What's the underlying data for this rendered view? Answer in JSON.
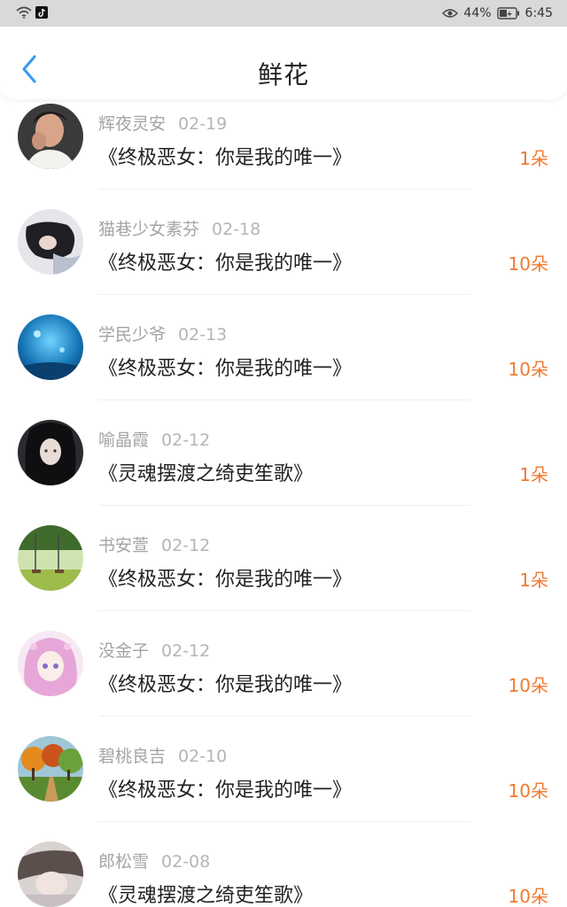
{
  "status_bar": {
    "battery": "44%",
    "time": "6:45"
  },
  "header": {
    "title": "鲜花"
  },
  "items": [
    {
      "name": "辉夜灵安",
      "date": "02-19",
      "book": "《终极恶女：你是我的唯一》",
      "count": "1朵"
    },
    {
      "name": "猫巷少女素芬",
      "date": "02-18",
      "book": "《终极恶女：你是我的唯一》",
      "count": "10朵"
    },
    {
      "name": "学民少爷",
      "date": "02-13",
      "book": "《终极恶女：你是我的唯一》",
      "count": "10朵"
    },
    {
      "name": "喻晶霞",
      "date": "02-12",
      "book": "《灵魂摆渡之绮吏笙歌》",
      "count": "1朵"
    },
    {
      "name": "书安萱",
      "date": "02-12",
      "book": "《终极恶女：你是我的唯一》",
      "count": "1朵"
    },
    {
      "name": "没金子",
      "date": "02-12",
      "book": "《终极恶女：你是我的唯一》",
      "count": "10朵"
    },
    {
      "name": "碧桃良吉",
      "date": "02-10",
      "book": "《终极恶女：你是我的唯一》",
      "count": "10朵"
    },
    {
      "name": "郎松雪",
      "date": "02-08",
      "book": "《灵魂摆渡之绮吏笙歌》",
      "count": "10朵"
    }
  ],
  "colors": {
    "accent_blue": "#3b9cf0",
    "count_orange": "#f07a30"
  }
}
